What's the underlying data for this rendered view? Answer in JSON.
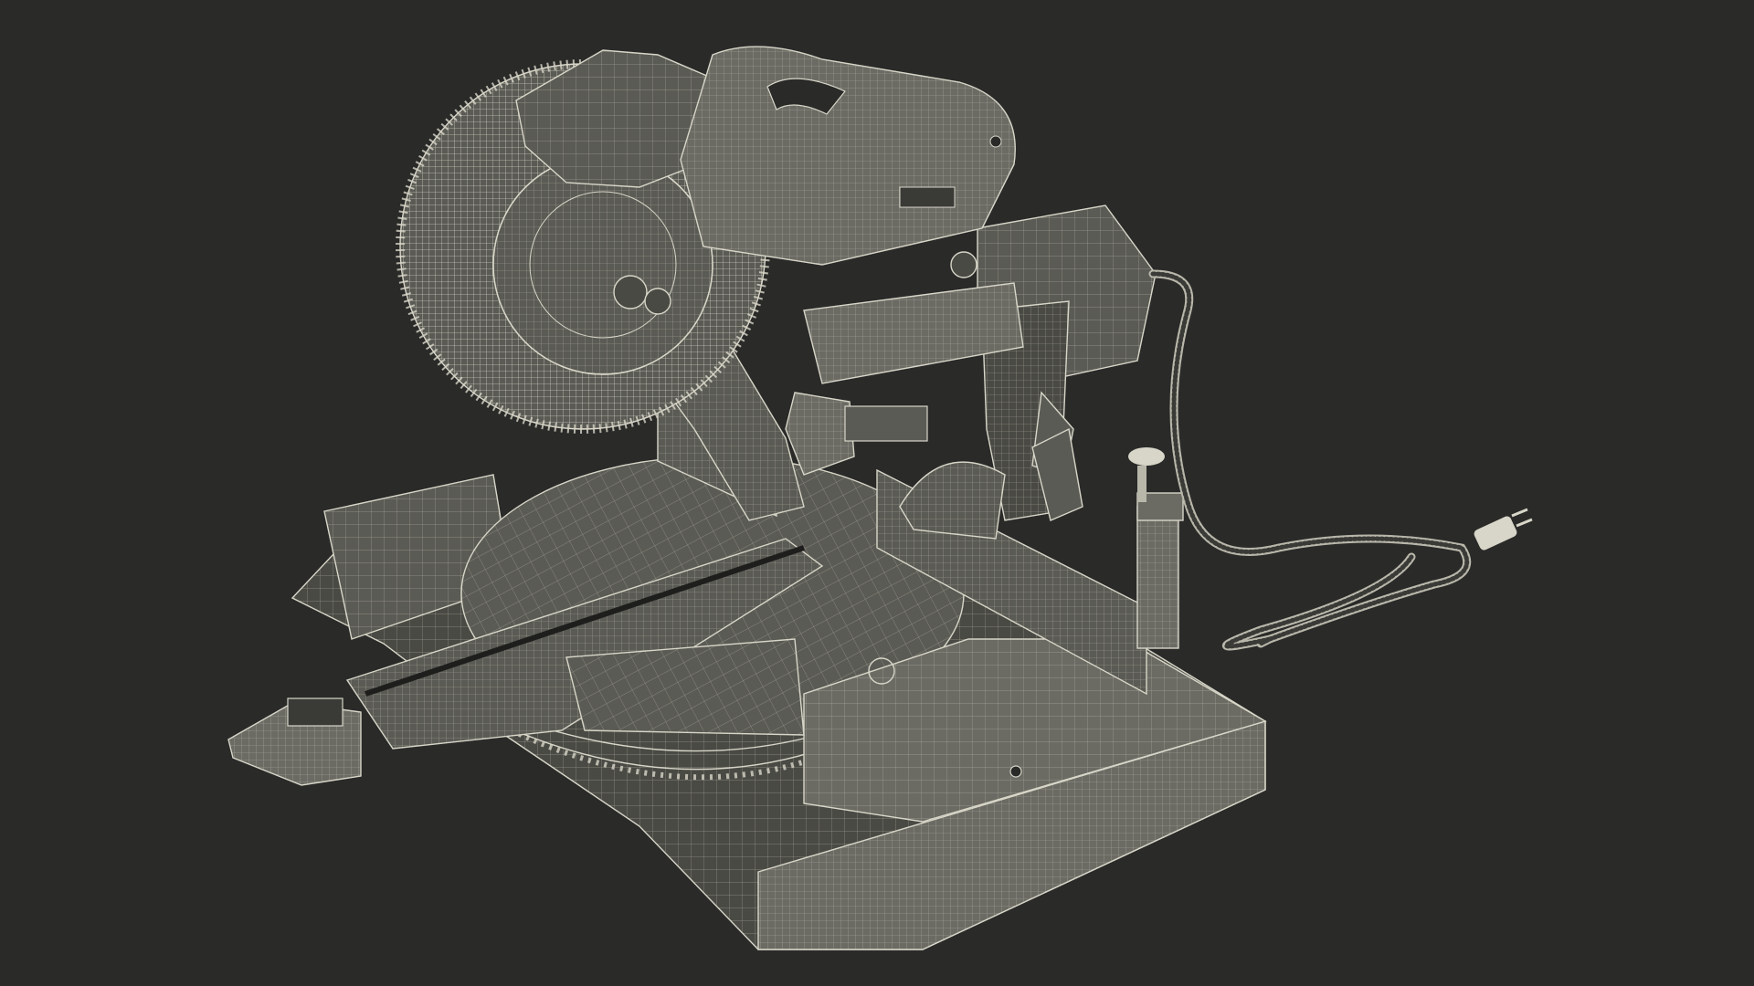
{
  "scene": {
    "background": "#2a2a29",
    "surface": "#5b5b55",
    "surface_dark": "#4a4a45",
    "surface_light": "#6b6b64",
    "wire": "#d8d6c8",
    "wire_dim": "#9f9d92",
    "subject": "miter-saw-wireframe-render"
  }
}
